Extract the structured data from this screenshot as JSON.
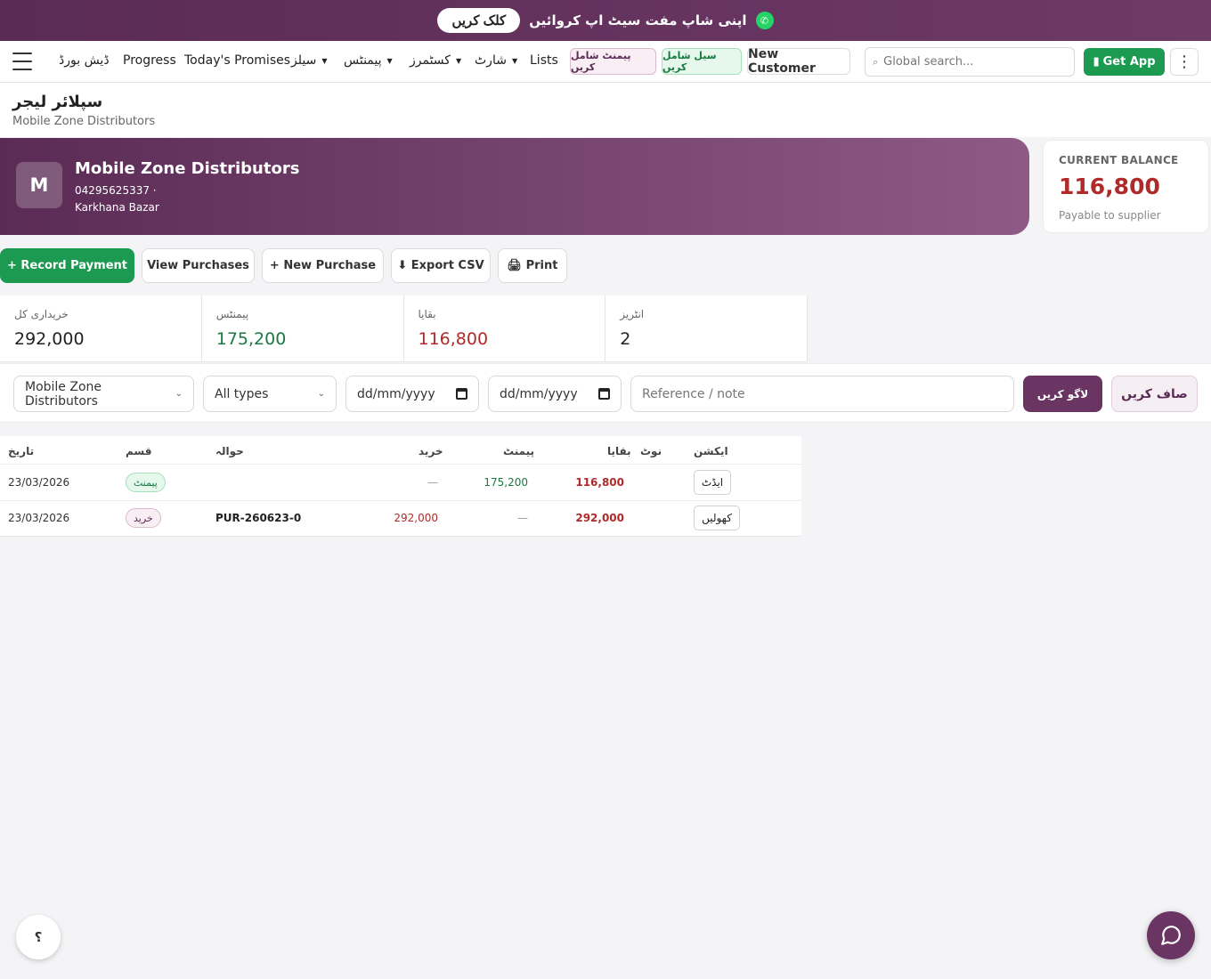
{
  "promo": {
    "text": "اپنی شاپ مفت سیٹ اپ کروائیں",
    "button": "کلک کریں"
  },
  "nav": {
    "links": [
      "ڈیش بورڈ",
      "Progress",
      "Today's Promises",
      "سیلز",
      "پیمنٹس",
      "کسٹمرز",
      "شارٹ",
      "Lists"
    ],
    "add_payment": "پیمنٹ شامل کریں",
    "add_sale": "سیل شامل کریں",
    "new_customer": "New Customer",
    "search_placeholder": "Global search...",
    "get_app": "Get App"
  },
  "page": {
    "title": "سپلائر لیجر",
    "subtitle": "Mobile Zone Distributors"
  },
  "supplier": {
    "initial": "M",
    "name": "Mobile Zone Distributors",
    "phone": "04295625337 ·",
    "address": "Karkhana Bazar"
  },
  "balance": {
    "label": "CURRENT BALANCE",
    "value": "116,800",
    "note": "Payable to supplier"
  },
  "actions": {
    "record_payment": "+ Record Payment",
    "view_purchases": "View Purchases",
    "new_purchase": "+ New Purchase",
    "export_csv": "⬇ Export CSV",
    "print": "🖨 Print"
  },
  "stats": [
    {
      "label": "خریداری کل",
      "value": "292,000"
    },
    {
      "label": "پیمنٹس",
      "value": "175,200"
    },
    {
      "label": "بقایا",
      "value": "116,800"
    },
    {
      "label": "انٹریز",
      "value": "2"
    }
  ],
  "filters": {
    "supplier": "Mobile Zone Distributors",
    "type": "All types",
    "date_from": "dd/mm/yyyy",
    "date_to": "dd/mm/yyyy",
    "reference_placeholder": "Reference / note",
    "apply": "لاگو کریں",
    "clear": "صاف کریں"
  },
  "table": {
    "headers": [
      "تاریخ",
      "قسم",
      "حوالہ",
      "خرید",
      "پیمنٹ",
      "بقایا",
      "نوٹ",
      "ایکشن"
    ],
    "rows": [
      {
        "date": "23/03/2026",
        "type": "پیمنٹ",
        "reference": "",
        "purchase": "—",
        "payment": "175,200",
        "balance": "116,800",
        "note": "",
        "action": "ایڈٹ"
      },
      {
        "date": "23/03/2026",
        "type": "خرید",
        "reference": "PUR-260623-0",
        "purchase": "292,000",
        "payment": "—",
        "balance": "292,000",
        "note": "",
        "action": "کھولیں"
      }
    ]
  },
  "help": "؟",
  "colors": {
    "brand": "#5a2b55",
    "accent_green": "#1d9a52",
    "negative_red": "#b02a2a"
  }
}
